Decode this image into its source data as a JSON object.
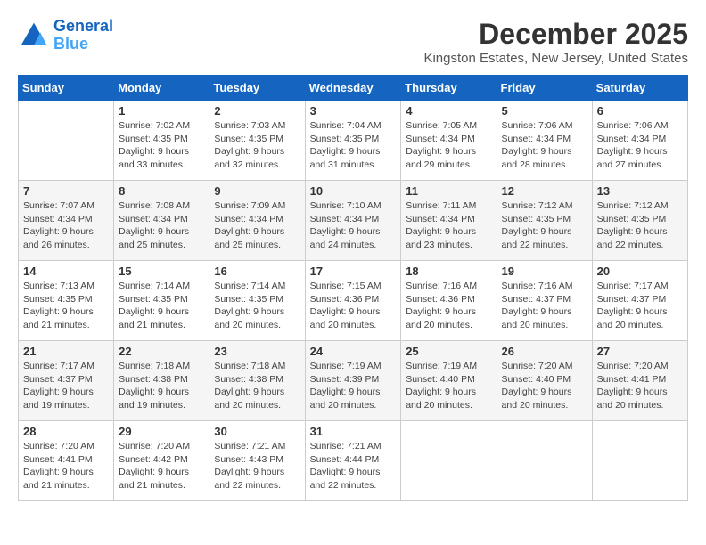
{
  "header": {
    "logo_line1": "General",
    "logo_line2": "Blue",
    "month": "December 2025",
    "location": "Kingston Estates, New Jersey, United States"
  },
  "days_of_week": [
    "Sunday",
    "Monday",
    "Tuesday",
    "Wednesday",
    "Thursday",
    "Friday",
    "Saturday"
  ],
  "weeks": [
    [
      {
        "day": "",
        "info": ""
      },
      {
        "day": "1",
        "info": "Sunrise: 7:02 AM\nSunset: 4:35 PM\nDaylight: 9 hours\nand 33 minutes."
      },
      {
        "day": "2",
        "info": "Sunrise: 7:03 AM\nSunset: 4:35 PM\nDaylight: 9 hours\nand 32 minutes."
      },
      {
        "day": "3",
        "info": "Sunrise: 7:04 AM\nSunset: 4:35 PM\nDaylight: 9 hours\nand 31 minutes."
      },
      {
        "day": "4",
        "info": "Sunrise: 7:05 AM\nSunset: 4:34 PM\nDaylight: 9 hours\nand 29 minutes."
      },
      {
        "day": "5",
        "info": "Sunrise: 7:06 AM\nSunset: 4:34 PM\nDaylight: 9 hours\nand 28 minutes."
      },
      {
        "day": "6",
        "info": "Sunrise: 7:06 AM\nSunset: 4:34 PM\nDaylight: 9 hours\nand 27 minutes."
      }
    ],
    [
      {
        "day": "7",
        "info": "Sunrise: 7:07 AM\nSunset: 4:34 PM\nDaylight: 9 hours\nand 26 minutes."
      },
      {
        "day": "8",
        "info": "Sunrise: 7:08 AM\nSunset: 4:34 PM\nDaylight: 9 hours\nand 25 minutes."
      },
      {
        "day": "9",
        "info": "Sunrise: 7:09 AM\nSunset: 4:34 PM\nDaylight: 9 hours\nand 25 minutes."
      },
      {
        "day": "10",
        "info": "Sunrise: 7:10 AM\nSunset: 4:34 PM\nDaylight: 9 hours\nand 24 minutes."
      },
      {
        "day": "11",
        "info": "Sunrise: 7:11 AM\nSunset: 4:34 PM\nDaylight: 9 hours\nand 23 minutes."
      },
      {
        "day": "12",
        "info": "Sunrise: 7:12 AM\nSunset: 4:35 PM\nDaylight: 9 hours\nand 22 minutes."
      },
      {
        "day": "13",
        "info": "Sunrise: 7:12 AM\nSunset: 4:35 PM\nDaylight: 9 hours\nand 22 minutes."
      }
    ],
    [
      {
        "day": "14",
        "info": "Sunrise: 7:13 AM\nSunset: 4:35 PM\nDaylight: 9 hours\nand 21 minutes."
      },
      {
        "day": "15",
        "info": "Sunrise: 7:14 AM\nSunset: 4:35 PM\nDaylight: 9 hours\nand 21 minutes."
      },
      {
        "day": "16",
        "info": "Sunrise: 7:14 AM\nSunset: 4:35 PM\nDaylight: 9 hours\nand 20 minutes."
      },
      {
        "day": "17",
        "info": "Sunrise: 7:15 AM\nSunset: 4:36 PM\nDaylight: 9 hours\nand 20 minutes."
      },
      {
        "day": "18",
        "info": "Sunrise: 7:16 AM\nSunset: 4:36 PM\nDaylight: 9 hours\nand 20 minutes."
      },
      {
        "day": "19",
        "info": "Sunrise: 7:16 AM\nSunset: 4:37 PM\nDaylight: 9 hours\nand 20 minutes."
      },
      {
        "day": "20",
        "info": "Sunrise: 7:17 AM\nSunset: 4:37 PM\nDaylight: 9 hours\nand 20 minutes."
      }
    ],
    [
      {
        "day": "21",
        "info": "Sunrise: 7:17 AM\nSunset: 4:37 PM\nDaylight: 9 hours\nand 19 minutes."
      },
      {
        "day": "22",
        "info": "Sunrise: 7:18 AM\nSunset: 4:38 PM\nDaylight: 9 hours\nand 19 minutes."
      },
      {
        "day": "23",
        "info": "Sunrise: 7:18 AM\nSunset: 4:38 PM\nDaylight: 9 hours\nand 20 minutes."
      },
      {
        "day": "24",
        "info": "Sunrise: 7:19 AM\nSunset: 4:39 PM\nDaylight: 9 hours\nand 20 minutes."
      },
      {
        "day": "25",
        "info": "Sunrise: 7:19 AM\nSunset: 4:40 PM\nDaylight: 9 hours\nand 20 minutes."
      },
      {
        "day": "26",
        "info": "Sunrise: 7:20 AM\nSunset: 4:40 PM\nDaylight: 9 hours\nand 20 minutes."
      },
      {
        "day": "27",
        "info": "Sunrise: 7:20 AM\nSunset: 4:41 PM\nDaylight: 9 hours\nand 20 minutes."
      }
    ],
    [
      {
        "day": "28",
        "info": "Sunrise: 7:20 AM\nSunset: 4:41 PM\nDaylight: 9 hours\nand 21 minutes."
      },
      {
        "day": "29",
        "info": "Sunrise: 7:20 AM\nSunset: 4:42 PM\nDaylight: 9 hours\nand 21 minutes."
      },
      {
        "day": "30",
        "info": "Sunrise: 7:21 AM\nSunset: 4:43 PM\nDaylight: 9 hours\nand 22 minutes."
      },
      {
        "day": "31",
        "info": "Sunrise: 7:21 AM\nSunset: 4:44 PM\nDaylight: 9 hours\nand 22 minutes."
      },
      {
        "day": "",
        "info": ""
      },
      {
        "day": "",
        "info": ""
      },
      {
        "day": "",
        "info": ""
      }
    ]
  ]
}
